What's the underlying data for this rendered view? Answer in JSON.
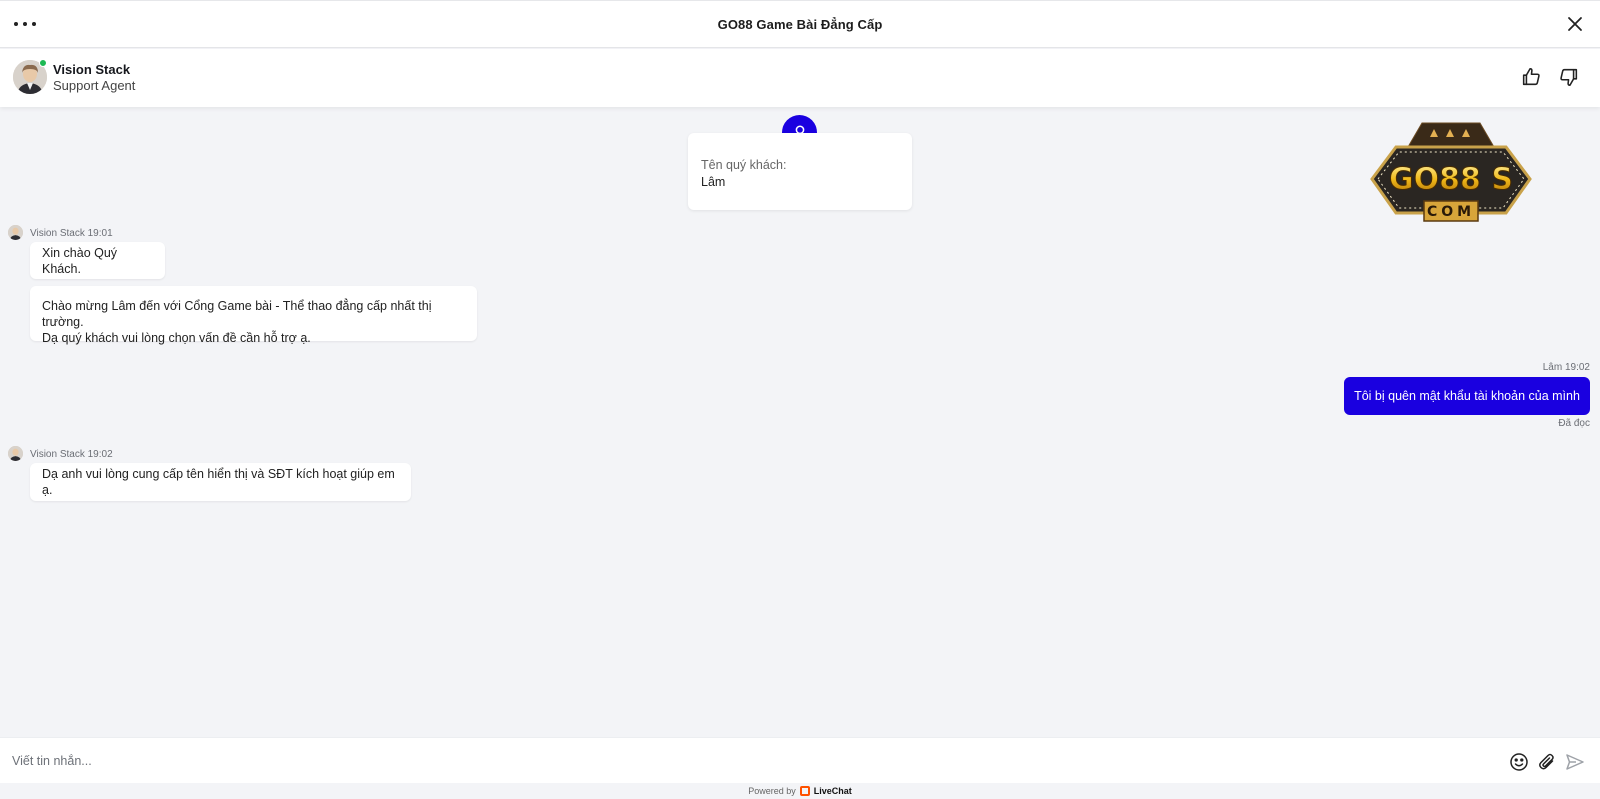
{
  "header": {
    "title": "GO88 Game Bài Đẳng Cấp",
    "menu_icon": "more-horizontal-icon",
    "close_icon": "close-icon"
  },
  "agent": {
    "name": "Vision Stack",
    "role": "Support Agent",
    "status_color": "#1db954"
  },
  "rating": {
    "up_icon": "thumbs-up-icon",
    "down_icon": "thumbs-down-icon"
  },
  "logo": {
    "main_text": "GO88 S",
    "sub_text": "COM"
  },
  "prechat": {
    "label": "Tên quý khách:",
    "value": "Lâm"
  },
  "messages": [
    {
      "author": "Vision Stack",
      "time": "19:01",
      "meta": "Vision Stack 19:01",
      "text": "Xin chào Quý Khách."
    },
    {
      "author": "Vision Stack",
      "time": "19:01",
      "line1": "Chào mừng Lâm đến với Cổng Game bài - Thể thao đẳng cấp nhất thị trường.",
      "line2": "Dạ quý khách vui lòng chọn vấn đề cần hỗ trợ ạ."
    },
    {
      "author": "Lâm",
      "time": "19:02",
      "meta": "Lâm 19:02",
      "text": "Tôi bị quên mật khẩu tài khoản của mình",
      "status": "Đã đọc"
    },
    {
      "author": "Vision Stack",
      "time": "19:02",
      "meta": "Vision Stack 19:02",
      "text": "Dạ anh vui lòng cung cấp tên hiển thị và SĐT kích hoạt giúp em ạ."
    }
  ],
  "composer": {
    "placeholder": "Viết tin nhắn...",
    "emoji_icon": "emoji-icon",
    "attach_icon": "paperclip-icon",
    "send_icon": "send-icon"
  },
  "footer": {
    "powered_by": "Powered by",
    "brand": "LiveChat"
  },
  "colors": {
    "accent": "#1a00e0",
    "background": "#f3f4f7"
  }
}
